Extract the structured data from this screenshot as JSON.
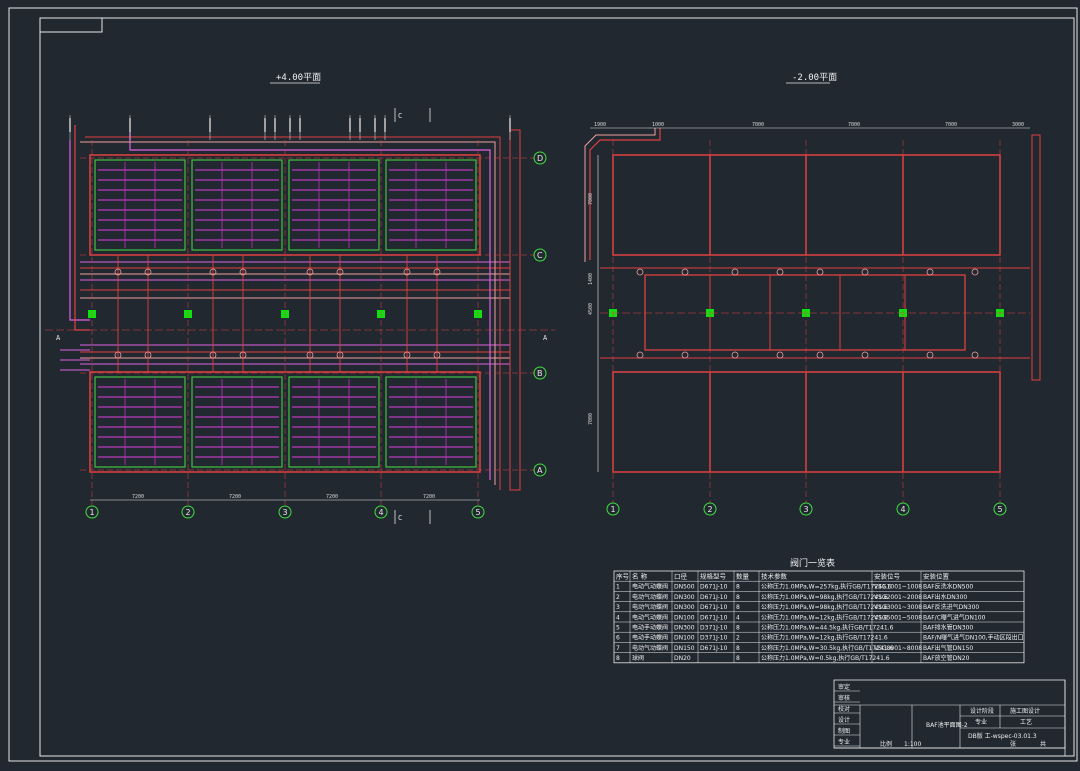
{
  "left_plan": {
    "title": "+4.00平面",
    "grid_rows": [
      "D",
      "C",
      "B",
      "A"
    ],
    "grid_cols": [
      "1",
      "2",
      "3",
      "4",
      "5"
    ],
    "dims_bottom": [
      "7200",
      "7200",
      "7200",
      "7200"
    ],
    "section_marks": [
      "A",
      "A",
      "C",
      "C"
    ]
  },
  "right_plan": {
    "title": "-2.00平面",
    "grid_cols": [
      "1",
      "2",
      "3",
      "4",
      "5"
    ],
    "dims_top": [
      "1900",
      "1000",
      "7000",
      "7000",
      "7000",
      "3000"
    ],
    "dims_left": [
      "7000",
      "1400",
      "4500",
      "7000"
    ]
  },
  "valve_table": {
    "title": "阀门一览表",
    "headers": [
      "序号",
      "名  称",
      "口径",
      "规格型号",
      "数量",
      "技术参数",
      "安装位号",
      "安装位置"
    ],
    "rows": [
      [
        "1",
        "电动气动蝶阀",
        "DN500",
        "D671J-10",
        "8",
        "公称压力1.0MPa,W=257kg,执行GB/T17241.6",
        "VSG1001~1008",
        "BAF反洗水DN500"
      ],
      [
        "2",
        "电动气动蝶阀",
        "DN300",
        "D671J-10",
        "8",
        "公称压力1.0MPa,W=98kg,执行GB/T17241.6",
        "VSG2001~2008",
        "BAF出水DN300"
      ],
      [
        "3",
        "电动气动蝶阀",
        "DN300",
        "D671J-10",
        "8",
        "公称压力1.0MPa,W=98kg,执行GB/T17241.6",
        "VSG3001~3008",
        "BAF反洗进气DN300"
      ],
      [
        "4",
        "电动气动蝶阀",
        "DN100",
        "D671J-10",
        "4",
        "公称压力1.0MPa,W=12kg,执行GB/T17241.6",
        "VSG5001~5008",
        "BAF/C曝气进气DN100"
      ],
      [
        "5",
        "电动手动蝶阀",
        "DN300",
        "D371J-10",
        "8",
        "公称压力1.0MPa,W=44.5kg,执行GB/T17241.6",
        "",
        "BAF排水管DN300"
      ],
      [
        "6",
        "电动手动蝶阀",
        "DN100",
        "D371J-10",
        "2",
        "公称压力1.0MPa,W=12kg,执行GB/T17241.6",
        "",
        "BAF/N曝气进气DN100,手动区段出口"
      ],
      [
        "7",
        "电动气动蝶阀",
        "DN150",
        "D671J-10",
        "8",
        "公称压力1.0MPa,W=30.5kg,执行GB/T17241.6",
        "VSG8001~8008",
        "BAF出气管DN150"
      ],
      [
        "8",
        "球阀",
        "DN20",
        "",
        "8",
        "公称压力1.0MPa,W=0.5kg,执行GB/T17241.6",
        "",
        "BAF放空管DN20"
      ]
    ]
  },
  "title_block": {
    "drawing_name": "BAF池平面图-2",
    "drawing_no": "DB版 工-wspec-03.01.3",
    "scale": "1:100",
    "design_stage": "设计阶段",
    "stage_value": "施工图设计",
    "discipline": "专业",
    "discipline_value": "工艺",
    "scale_label": "比例",
    "sheet_label": "张",
    "sheets_label": "共",
    "row_labels": [
      "审定",
      "审核",
      "校对",
      "设计",
      "制图",
      "专业"
    ]
  }
}
